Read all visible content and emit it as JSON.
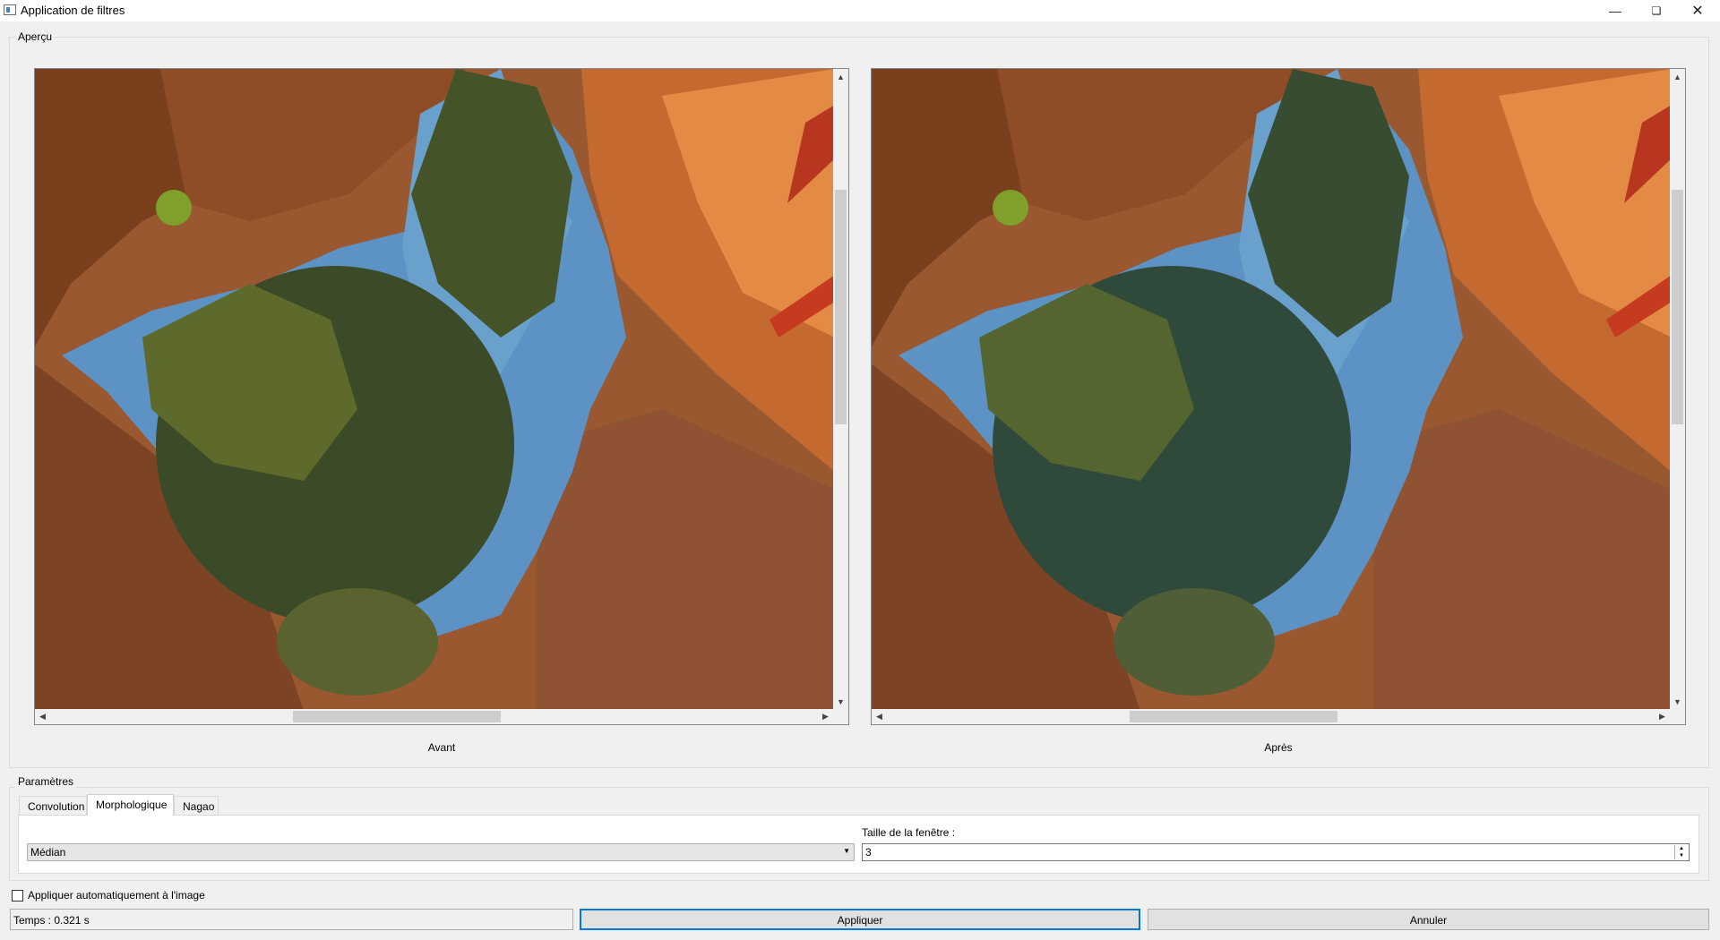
{
  "window": {
    "title": "Application de filtres",
    "controls": [
      "minimize-icon",
      "restore-icon",
      "close-icon"
    ]
  },
  "preview": {
    "label": "Aperçu",
    "before_caption": "Avant",
    "after_caption": "Après"
  },
  "parameters": {
    "label": "Paramètres",
    "tabs": [
      {
        "label": "Convolution",
        "active": false
      },
      {
        "label": "Morphologique",
        "active": true
      },
      {
        "label": "Nagao",
        "active": false
      }
    ],
    "filter_select": {
      "value": "Médian"
    },
    "window_size": {
      "label": "Taille de la fenêtre :",
      "value": "3"
    }
  },
  "auto_apply": {
    "label": "Appliquer automatiquement à l'image",
    "checked": false
  },
  "status": {
    "text": "Temps : 0.321 s"
  },
  "buttons": {
    "apply": "Appliquer",
    "cancel": "Annuler"
  },
  "colors": {
    "accent": "#0078d7",
    "sky": "#4f8fc2",
    "rock": "#a45a2c",
    "foliage": "#3a4a26"
  }
}
